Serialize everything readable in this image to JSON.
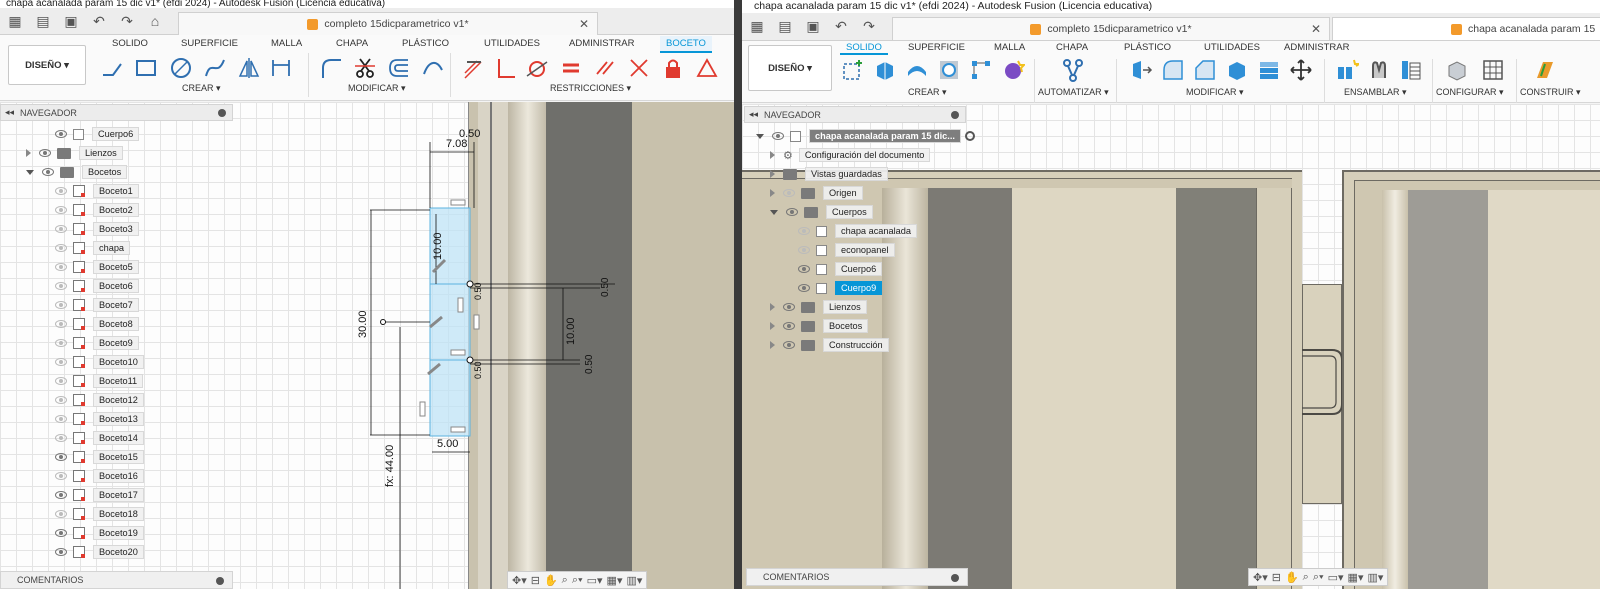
{
  "left": {
    "window_title": "chapa acanalada param 15 dic v1* (efdi 2024) - Autodesk Fusion (Licencia educativa)",
    "doc_tab": "completo 15dicparametrico v1*",
    "design_button": "DISEÑO",
    "ribbon_tabs": [
      "SOLIDO",
      "SUPERFICIE",
      "MALLA",
      "CHAPA",
      "PLÁSTICO",
      "UTILIDADES",
      "ADMINISTRAR",
      "BOCETO"
    ],
    "groups": [
      "CREAR",
      "MODIFICAR",
      "RESTRICCIONES"
    ],
    "navigator": "NAVEGADOR",
    "tree": [
      {
        "label": "Cuerpo6",
        "type": "body"
      },
      {
        "label": "Lienzos",
        "type": "folder"
      },
      {
        "label": "Bocetos",
        "type": "folder"
      },
      {
        "label": "Boceto1",
        "type": "sketch"
      },
      {
        "label": "Boceto2",
        "type": "sketch"
      },
      {
        "label": "Boceto3",
        "type": "sketch"
      },
      {
        "label": "chapa",
        "type": "sketch"
      },
      {
        "label": "Boceto5",
        "type": "sketch"
      },
      {
        "label": "Boceto6",
        "type": "sketch"
      },
      {
        "label": "Boceto7",
        "type": "sketch"
      },
      {
        "label": "Boceto8",
        "type": "sketch"
      },
      {
        "label": "Boceto9",
        "type": "sketch"
      },
      {
        "label": "Boceto10",
        "type": "sketch"
      },
      {
        "label": "Boceto11",
        "type": "sketch"
      },
      {
        "label": "Boceto12",
        "type": "sketch"
      },
      {
        "label": "Boceto13",
        "type": "sketch"
      },
      {
        "label": "Boceto14",
        "type": "sketch"
      },
      {
        "label": "Boceto15",
        "type": "sketch"
      },
      {
        "label": "Boceto16",
        "type": "sketch"
      },
      {
        "label": "Boceto17",
        "type": "sketch"
      },
      {
        "label": "Boceto18",
        "type": "sketch"
      },
      {
        "label": "Boceto19",
        "type": "sketch"
      },
      {
        "label": "Boceto20",
        "type": "sketch"
      }
    ],
    "comments": "COMENTARIOS",
    "dimensions": [
      "0.50",
      "7.08",
      "10.00",
      "0.50",
      "30.00",
      "10.00",
      "0.50",
      "0.50",
      "0.50",
      "5.00",
      "fx: 44.00"
    ]
  },
  "right": {
    "window_title": "chapa acanalada param 15 dic v1* (efdi 2024) - Autodesk Fusion (Licencia educativa)",
    "doc_tab_1": "completo 15dicparametrico v1*",
    "doc_tab_2": "chapa acanalada param 15",
    "design_button": "DISEÑO",
    "ribbon_tabs": [
      "SOLIDO",
      "SUPERFICIE",
      "MALLA",
      "CHAPA",
      "PLÁSTICO",
      "UTILIDADES",
      "ADMINISTRAR"
    ],
    "groups": [
      "CREAR",
      "AUTOMATIZAR",
      "MODIFICAR",
      "ENSAMBLAR",
      "CONFIGURAR",
      "CONSTRUIR"
    ],
    "navigator": "NAVEGADOR",
    "root": "chapa acanalada param 15 dic...",
    "tree": [
      {
        "label": "Configuración del documento",
        "type": "gear"
      },
      {
        "label": "Vistas guardadas",
        "type": "folder"
      },
      {
        "label": "Origen",
        "type": "folder"
      },
      {
        "label": "Cuerpos",
        "type": "folder"
      },
      {
        "label": "chapa acanalada",
        "type": "body"
      },
      {
        "label": "econopanel",
        "type": "body"
      },
      {
        "label": "Cuerpo6",
        "type": "body"
      },
      {
        "label": "Cuerpo9",
        "type": "body",
        "selected": true
      },
      {
        "label": "Lienzos",
        "type": "folder"
      },
      {
        "label": "Bocetos",
        "type": "folder"
      },
      {
        "label": "Construcción",
        "type": "folder"
      }
    ],
    "comments": "COMENTARIOS"
  },
  "colors": {
    "accent": "#0696d7",
    "sketch_red": "#e03a2f",
    "doc_orange": "#f39a2b"
  }
}
